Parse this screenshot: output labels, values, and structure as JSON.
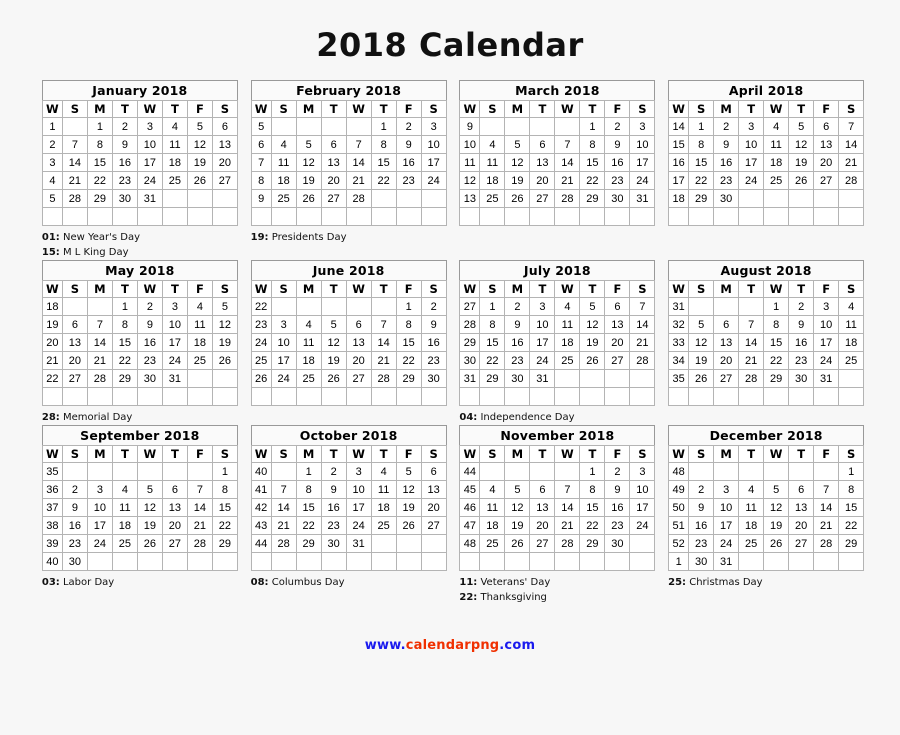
{
  "title": "2018 Calendar",
  "weekday_headers": [
    "W",
    "S",
    "M",
    "T",
    "W",
    "T",
    "F",
    "S"
  ],
  "footer": {
    "prefix": "www.",
    "name": "calendarpng",
    "suffix": ".com",
    "blue": "#1a1aee",
    "red": "#f03000"
  },
  "colors": {
    "week_number": "#33cc44",
    "sunday": "#f04000",
    "saturday": "#2222ee",
    "weekday": "#000000",
    "holiday": "#ee0000",
    "background": "#f7f7f7",
    "grid_border": "#b4b4b4"
  },
  "months": [
    {
      "name": "January 2018",
      "weeks": [
        {
          "wk": "1",
          "days": [
            "",
            "1",
            "2",
            "3",
            "4",
            "5",
            "6"
          ],
          "holidays": [
            1
          ]
        },
        {
          "wk": "2",
          "days": [
            "7",
            "8",
            "9",
            "10",
            "11",
            "12",
            "13"
          ],
          "holidays": []
        },
        {
          "wk": "3",
          "days": [
            "14",
            "15",
            "16",
            "17",
            "18",
            "19",
            "20"
          ],
          "holidays": [
            15
          ]
        },
        {
          "wk": "4",
          "days": [
            "21",
            "22",
            "23",
            "24",
            "25",
            "26",
            "27"
          ],
          "holidays": []
        },
        {
          "wk": "5",
          "days": [
            "28",
            "29",
            "30",
            "31",
            "",
            "",
            ""
          ],
          "holidays": []
        },
        {
          "wk": "",
          "days": [
            "",
            "",
            "",
            "",
            "",
            "",
            ""
          ],
          "holidays": []
        }
      ],
      "notes": [
        {
          "day": "01:",
          "label": "New Year's Day"
        },
        {
          "day": "15:",
          "label": "M L King Day"
        }
      ]
    },
    {
      "name": "February 2018",
      "weeks": [
        {
          "wk": "5",
          "days": [
            "",
            "",
            "",
            "",
            "1",
            "2",
            "3"
          ],
          "holidays": []
        },
        {
          "wk": "6",
          "days": [
            "4",
            "5",
            "6",
            "7",
            "8",
            "9",
            "10"
          ],
          "holidays": []
        },
        {
          "wk": "7",
          "days": [
            "11",
            "12",
            "13",
            "14",
            "15",
            "16",
            "17"
          ],
          "holidays": []
        },
        {
          "wk": "8",
          "days": [
            "18",
            "19",
            "20",
            "21",
            "22",
            "23",
            "24"
          ],
          "holidays": [
            19
          ]
        },
        {
          "wk": "9",
          "days": [
            "25",
            "26",
            "27",
            "28",
            "",
            "",
            ""
          ],
          "holidays": []
        },
        {
          "wk": "",
          "days": [
            "",
            "",
            "",
            "",
            "",
            "",
            ""
          ],
          "holidays": []
        }
      ],
      "notes": [
        {
          "day": "19:",
          "label": "Presidents Day"
        }
      ]
    },
    {
      "name": "March 2018",
      "weeks": [
        {
          "wk": "9",
          "days": [
            "",
            "",
            "",
            "",
            "1",
            "2",
            "3"
          ],
          "holidays": []
        },
        {
          "wk": "10",
          "days": [
            "4",
            "5",
            "6",
            "7",
            "8",
            "9",
            "10"
          ],
          "holidays": []
        },
        {
          "wk": "11",
          "days": [
            "11",
            "12",
            "13",
            "14",
            "15",
            "16",
            "17"
          ],
          "holidays": []
        },
        {
          "wk": "12",
          "days": [
            "18",
            "19",
            "20",
            "21",
            "22",
            "23",
            "24"
          ],
          "holidays": []
        },
        {
          "wk": "13",
          "days": [
            "25",
            "26",
            "27",
            "28",
            "29",
            "30",
            "31"
          ],
          "holidays": []
        },
        {
          "wk": "",
          "days": [
            "",
            "",
            "",
            "",
            "",
            "",
            ""
          ],
          "holidays": []
        }
      ],
      "notes": []
    },
    {
      "name": "April 2018",
      "weeks": [
        {
          "wk": "14",
          "days": [
            "1",
            "2",
            "3",
            "4",
            "5",
            "6",
            "7"
          ],
          "holidays": []
        },
        {
          "wk": "15",
          "days": [
            "8",
            "9",
            "10",
            "11",
            "12",
            "13",
            "14"
          ],
          "holidays": []
        },
        {
          "wk": "16",
          "days": [
            "15",
            "16",
            "17",
            "18",
            "19",
            "20",
            "21"
          ],
          "holidays": []
        },
        {
          "wk": "17",
          "days": [
            "22",
            "23",
            "24",
            "25",
            "26",
            "27",
            "28"
          ],
          "holidays": []
        },
        {
          "wk": "18",
          "days": [
            "29",
            "30",
            "",
            "",
            "",
            "",
            ""
          ],
          "holidays": []
        },
        {
          "wk": "",
          "days": [
            "",
            "",
            "",
            "",
            "",
            "",
            ""
          ],
          "holidays": []
        }
      ],
      "notes": []
    },
    {
      "name": "May 2018",
      "weeks": [
        {
          "wk": "18",
          "days": [
            "",
            "",
            "1",
            "2",
            "3",
            "4",
            "5"
          ],
          "holidays": []
        },
        {
          "wk": "19",
          "days": [
            "6",
            "7",
            "8",
            "9",
            "10",
            "11",
            "12"
          ],
          "holidays": []
        },
        {
          "wk": "20",
          "days": [
            "13",
            "14",
            "15",
            "16",
            "17",
            "18",
            "19"
          ],
          "holidays": []
        },
        {
          "wk": "21",
          "days": [
            "20",
            "21",
            "22",
            "23",
            "24",
            "25",
            "26"
          ],
          "holidays": []
        },
        {
          "wk": "22",
          "days": [
            "27",
            "28",
            "29",
            "30",
            "31",
            "",
            ""
          ],
          "holidays": [
            28
          ]
        },
        {
          "wk": "",
          "days": [
            "",
            "",
            "",
            "",
            "",
            "",
            ""
          ],
          "holidays": []
        }
      ],
      "notes": [
        {
          "day": "28:",
          "label": "Memorial Day"
        }
      ]
    },
    {
      "name": "June 2018",
      "weeks": [
        {
          "wk": "22",
          "days": [
            "",
            "",
            "",
            "",
            "",
            "1",
            "2"
          ],
          "holidays": []
        },
        {
          "wk": "23",
          "days": [
            "3",
            "4",
            "5",
            "6",
            "7",
            "8",
            "9"
          ],
          "holidays": []
        },
        {
          "wk": "24",
          "days": [
            "10",
            "11",
            "12",
            "13",
            "14",
            "15",
            "16"
          ],
          "holidays": []
        },
        {
          "wk": "25",
          "days": [
            "17",
            "18",
            "19",
            "20",
            "21",
            "22",
            "23"
          ],
          "holidays": []
        },
        {
          "wk": "26",
          "days": [
            "24",
            "25",
            "26",
            "27",
            "28",
            "29",
            "30"
          ],
          "holidays": []
        },
        {
          "wk": "",
          "days": [
            "",
            "",
            "",
            "",
            "",
            "",
            ""
          ],
          "holidays": []
        }
      ],
      "notes": []
    },
    {
      "name": "July 2018",
      "weeks": [
        {
          "wk": "27",
          "days": [
            "1",
            "2",
            "3",
            "4",
            "5",
            "6",
            "7"
          ],
          "holidays": [
            4
          ]
        },
        {
          "wk": "28",
          "days": [
            "8",
            "9",
            "10",
            "11",
            "12",
            "13",
            "14"
          ],
          "holidays": []
        },
        {
          "wk": "29",
          "days": [
            "15",
            "16",
            "17",
            "18",
            "19",
            "20",
            "21"
          ],
          "holidays": []
        },
        {
          "wk": "30",
          "days": [
            "22",
            "23",
            "24",
            "25",
            "26",
            "27",
            "28"
          ],
          "holidays": []
        },
        {
          "wk": "31",
          "days": [
            "29",
            "30",
            "31",
            "",
            "",
            "",
            ""
          ],
          "holidays": []
        },
        {
          "wk": "",
          "days": [
            "",
            "",
            "",
            "",
            "",
            "",
            ""
          ],
          "holidays": []
        }
      ],
      "notes": [
        {
          "day": "04:",
          "label": "Independence Day"
        }
      ]
    },
    {
      "name": "August 2018",
      "weeks": [
        {
          "wk": "31",
          "days": [
            "",
            "",
            "",
            "1",
            "2",
            "3",
            "4"
          ],
          "holidays": []
        },
        {
          "wk": "32",
          "days": [
            "5",
            "6",
            "7",
            "8",
            "9",
            "10",
            "11"
          ],
          "holidays": []
        },
        {
          "wk": "33",
          "days": [
            "12",
            "13",
            "14",
            "15",
            "16",
            "17",
            "18"
          ],
          "holidays": []
        },
        {
          "wk": "34",
          "days": [
            "19",
            "20",
            "21",
            "22",
            "23",
            "24",
            "25"
          ],
          "holidays": []
        },
        {
          "wk": "35",
          "days": [
            "26",
            "27",
            "28",
            "29",
            "30",
            "31",
            ""
          ],
          "holidays": []
        },
        {
          "wk": "",
          "days": [
            "",
            "",
            "",
            "",
            "",
            "",
            ""
          ],
          "holidays": []
        }
      ],
      "notes": []
    },
    {
      "name": "September 2018",
      "weeks": [
        {
          "wk": "35",
          "days": [
            "",
            "",
            "",
            "",
            "",
            "",
            "1"
          ],
          "holidays": []
        },
        {
          "wk": "36",
          "days": [
            "2",
            "3",
            "4",
            "5",
            "6",
            "7",
            "8"
          ],
          "holidays": [
            3
          ]
        },
        {
          "wk": "37",
          "days": [
            "9",
            "10",
            "11",
            "12",
            "13",
            "14",
            "15"
          ],
          "holidays": []
        },
        {
          "wk": "38",
          "days": [
            "16",
            "17",
            "18",
            "19",
            "20",
            "21",
            "22"
          ],
          "holidays": []
        },
        {
          "wk": "39",
          "days": [
            "23",
            "24",
            "25",
            "26",
            "27",
            "28",
            "29"
          ],
          "holidays": []
        },
        {
          "wk": "40",
          "days": [
            "30",
            "",
            "",
            "",
            "",
            "",
            ""
          ],
          "holidays": []
        }
      ],
      "notes": [
        {
          "day": "03:",
          "label": "Labor Day"
        }
      ]
    },
    {
      "name": "October 2018",
      "weeks": [
        {
          "wk": "40",
          "days": [
            "",
            "1",
            "2",
            "3",
            "4",
            "5",
            "6"
          ],
          "holidays": []
        },
        {
          "wk": "41",
          "days": [
            "7",
            "8",
            "9",
            "10",
            "11",
            "12",
            "13"
          ],
          "holidays": [
            8
          ]
        },
        {
          "wk": "42",
          "days": [
            "14",
            "15",
            "16",
            "17",
            "18",
            "19",
            "20"
          ],
          "holidays": []
        },
        {
          "wk": "43",
          "days": [
            "21",
            "22",
            "23",
            "24",
            "25",
            "26",
            "27"
          ],
          "holidays": []
        },
        {
          "wk": "44",
          "days": [
            "28",
            "29",
            "30",
            "31",
            "",
            "",
            ""
          ],
          "holidays": []
        },
        {
          "wk": "",
          "days": [
            "",
            "",
            "",
            "",
            "",
            "",
            ""
          ],
          "holidays": []
        }
      ],
      "notes": [
        {
          "day": "08:",
          "label": "Columbus Day"
        }
      ]
    },
    {
      "name": "November 2018",
      "weeks": [
        {
          "wk": "44",
          "days": [
            "",
            "",
            "",
            "",
            "1",
            "2",
            "3"
          ],
          "holidays": []
        },
        {
          "wk": "45",
          "days": [
            "4",
            "5",
            "6",
            "7",
            "8",
            "9",
            "10"
          ],
          "holidays": []
        },
        {
          "wk": "46",
          "days": [
            "11",
            "12",
            "13",
            "14",
            "15",
            "16",
            "17"
          ],
          "holidays": [
            11
          ]
        },
        {
          "wk": "47",
          "days": [
            "18",
            "19",
            "20",
            "21",
            "22",
            "23",
            "24"
          ],
          "holidays": [
            22
          ]
        },
        {
          "wk": "48",
          "days": [
            "25",
            "26",
            "27",
            "28",
            "29",
            "30",
            ""
          ],
          "holidays": []
        },
        {
          "wk": "",
          "days": [
            "",
            "",
            "",
            "",
            "",
            "",
            ""
          ],
          "holidays": []
        }
      ],
      "notes": [
        {
          "day": "11:",
          "label": "Veterans' Day"
        },
        {
          "day": "22:",
          "label": "Thanksgiving"
        }
      ]
    },
    {
      "name": "December 2018",
      "weeks": [
        {
          "wk": "48",
          "days": [
            "",
            "",
            "",
            "",
            "",
            "",
            "1"
          ],
          "holidays": []
        },
        {
          "wk": "49",
          "days": [
            "2",
            "3",
            "4",
            "5",
            "6",
            "7",
            "8"
          ],
          "holidays": []
        },
        {
          "wk": "50",
          "days": [
            "9",
            "10",
            "11",
            "12",
            "13",
            "14",
            "15"
          ],
          "holidays": []
        },
        {
          "wk": "51",
          "days": [
            "16",
            "17",
            "18",
            "19",
            "20",
            "21",
            "22"
          ],
          "holidays": []
        },
        {
          "wk": "52",
          "days": [
            "23",
            "24",
            "25",
            "26",
            "27",
            "28",
            "29"
          ],
          "holidays": [
            25
          ]
        },
        {
          "wk": "1",
          "days": [
            "30",
            "31",
            "",
            "",
            "",
            "",
            ""
          ],
          "holidays": []
        }
      ],
      "notes": [
        {
          "day": "25:",
          "label": "Christmas Day"
        }
      ]
    }
  ]
}
